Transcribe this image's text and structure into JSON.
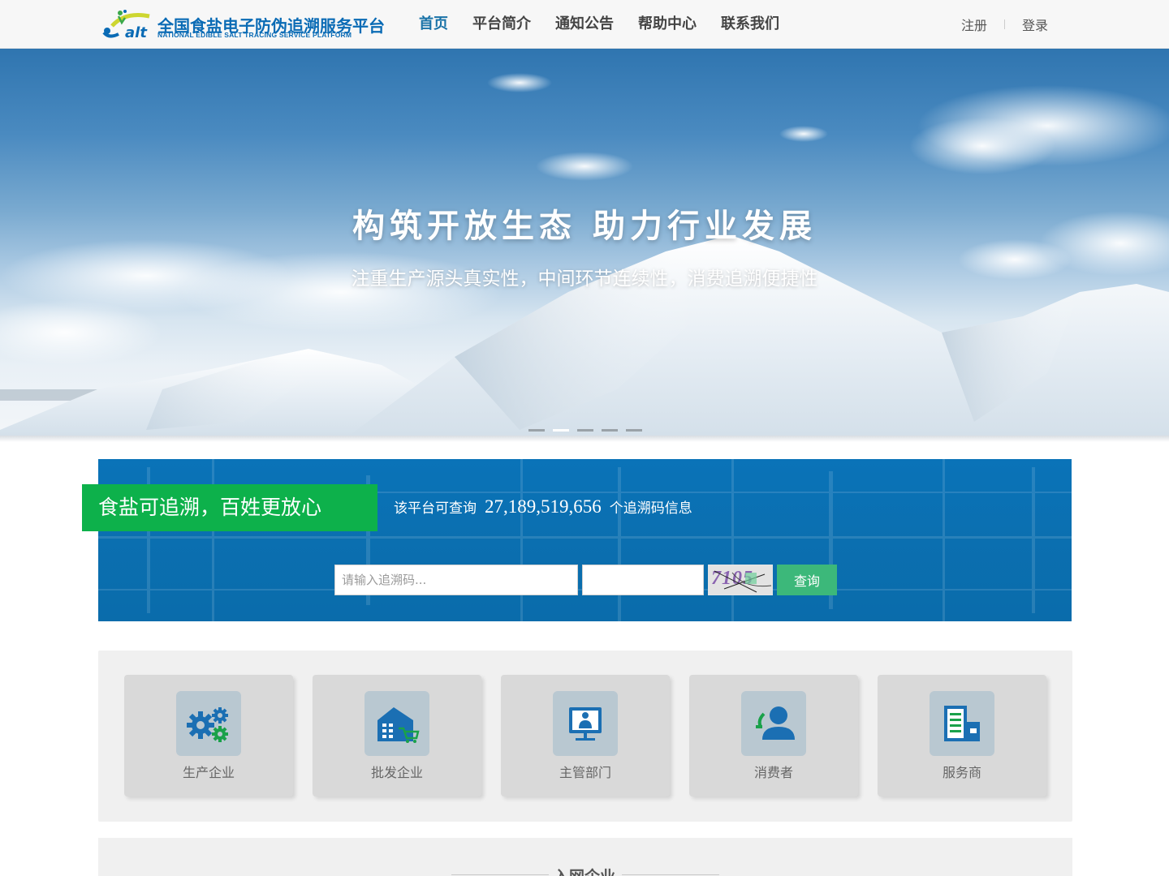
{
  "header": {
    "logo": {
      "mark_text": "alt",
      "title_cn": "全国食盐电子防伪追溯服务平台",
      "title_en": "NATIONAL EDIBLE SALT TRACING SERVICE PLATFORM"
    },
    "nav": [
      {
        "label": "首页",
        "active": true
      },
      {
        "label": "平台简介",
        "active": false
      },
      {
        "label": "通知公告",
        "active": false
      },
      {
        "label": "帮助中心",
        "active": false
      },
      {
        "label": "联系我们",
        "active": false
      }
    ],
    "register_label": "注册",
    "login_label": "登录"
  },
  "hero": {
    "title": "构筑开放生态 助力行业发展",
    "subtitle": "注重生产源头真实性，中间环节连续性，消费追溯便捷性",
    "slide_count": 5,
    "active_slide": 2
  },
  "search": {
    "slogan": "食盐可追溯，百姓更放心",
    "stat_prefix": "该平台可查询",
    "stat_number": "27,189,519,656",
    "stat_suffix": "个追溯码信息",
    "input_placeholder": "请输入追溯码...",
    "captcha_text": "7105",
    "query_button": "查询"
  },
  "categories": [
    {
      "label": "生产企业",
      "icon": "gears-icon"
    },
    {
      "label": "批发企业",
      "icon": "warehouse-cart-icon"
    },
    {
      "label": "主管部门",
      "icon": "officer-screen-icon"
    },
    {
      "label": "消费者",
      "icon": "consumer-person-icon"
    },
    {
      "label": "服务商",
      "icon": "building-document-icon"
    }
  ],
  "network_section": {
    "title": "入网企业"
  },
  "colors": {
    "nav_active": "#1a73a8",
    "band_blue": "#0a73b8",
    "slogan_green": "#0db14b",
    "query_green": "#3cb87a",
    "icon_blue": "#1b6fb3",
    "icon_green": "#1aa14a"
  }
}
